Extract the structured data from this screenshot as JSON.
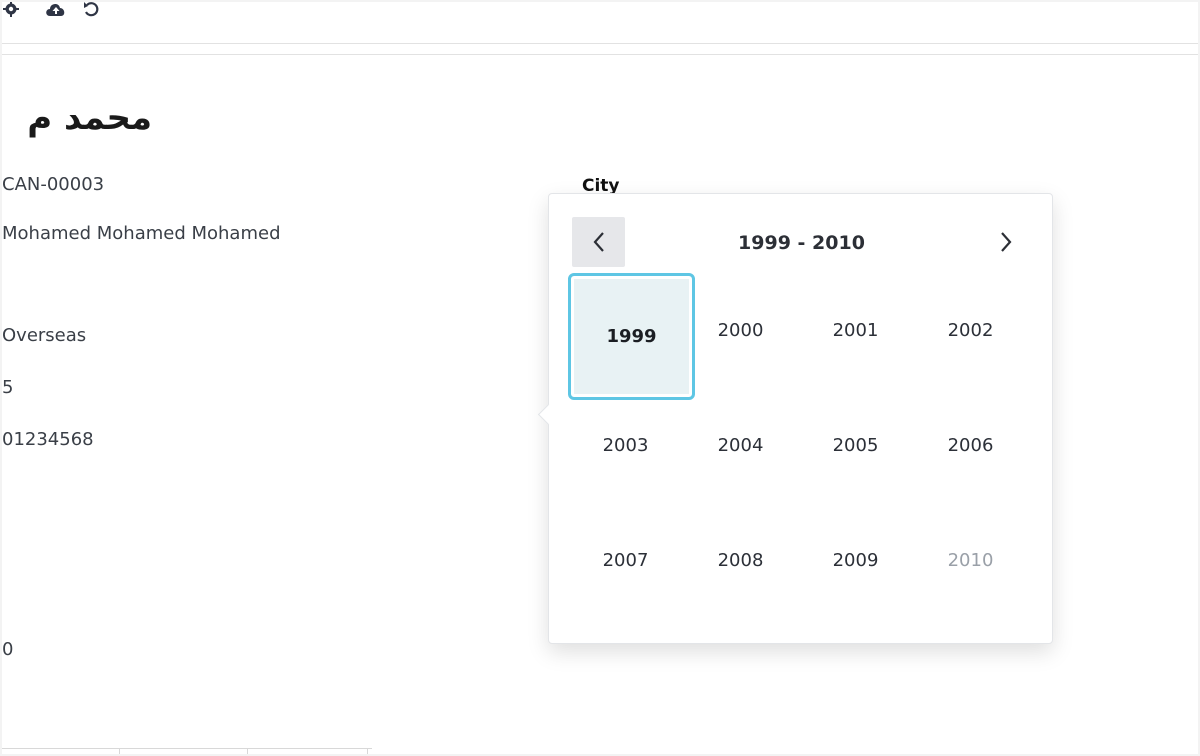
{
  "toolbar": {
    "icons": [
      "gear-icon",
      "cloud-upload-icon",
      "undo-icon"
    ]
  },
  "record": {
    "title": "محمد م",
    "fields": [
      "CAN-00003",
      "Mohamed Mohamed Mohamed",
      "Overseas",
      "5",
      "01234568",
      "0"
    ]
  },
  "form": {
    "city_label": "City"
  },
  "picker": {
    "range_title": "1999 - 2010",
    "years": [
      "1999",
      "2000",
      "2001",
      "2002",
      "2003",
      "2004",
      "2005",
      "2006",
      "2007",
      "2008",
      "2009",
      "2010"
    ],
    "selected": "1999",
    "out_of_range": "2010"
  },
  "colors": {
    "selection_border": "#5ec6e4",
    "selection_fill": "#e8f2f4",
    "nav_button": "#e6e7ea"
  }
}
